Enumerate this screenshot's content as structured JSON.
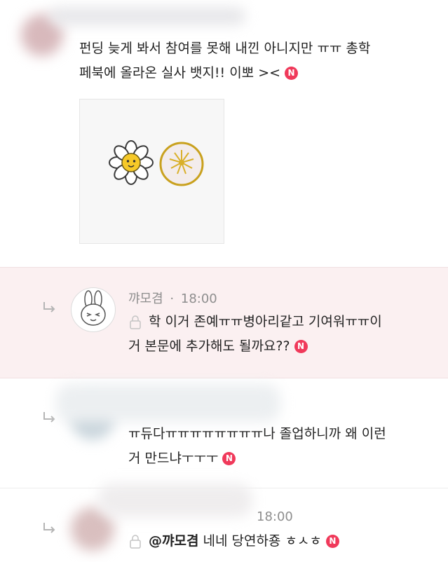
{
  "comment1": {
    "text_line1": "펀딩 늦게 봐서 참여를 못해 내낀 아니지만 ㅠㅠ 총학",
    "text_line2": "페북에 올라온 실사 뱃지!! 이뽀 ><",
    "new_badge": "N"
  },
  "reply1": {
    "author": "꺄모겸",
    "separator": "·",
    "time": "18:00",
    "text_line1": "학 이거 존예ㅠㅠ병아리같고 기여워ㅠㅠ이",
    "text_line2": "거 본문에 추가해도 될까요??",
    "new_badge": "N"
  },
  "reply2": {
    "text_line1": "ㅠ듀다ㅠㅠㅠㅠㅠㅠㅠㅠ나 졸업하니까 왜 이런",
    "text_line2": "거 만드냐ㅜㅜㅜ",
    "new_badge": "N"
  },
  "reply3": {
    "time": "18:00",
    "mention": "@꺄모겸",
    "text": " 네네 당연하죵 ㅎㅅㅎ",
    "new_badge": "N"
  },
  "colors": {
    "highlight_bg": "#fbf0f1",
    "new_badge": "#f0395a",
    "meta_text": "#8e8e8e"
  }
}
